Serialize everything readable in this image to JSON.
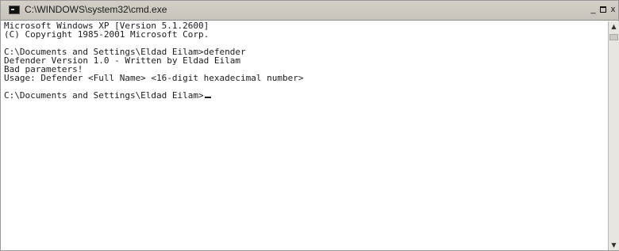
{
  "window": {
    "title": "C:\\WINDOWS\\system32\\cmd.exe",
    "icon": "cmd-icon",
    "controls": {
      "minimize": "_",
      "close": "x"
    }
  },
  "console": {
    "lines": [
      "Microsoft Windows XP [Version 5.1.2600]",
      "(C) Copyright 1985-2001 Microsoft Corp.",
      "",
      "C:\\Documents and Settings\\Eldad Eilam>defender",
      "Defender Version 1.0 - Written by Eldad Eilam",
      "Bad parameters!",
      "Usage: Defender <Full Name> <16-digit hexadecimal number>",
      "",
      "C:\\Documents and Settings\\Eldad Eilam>"
    ]
  },
  "scrollbar": {
    "up_icon": "scroll-up-arrow-icon",
    "down_icon": "scroll-down-arrow-icon"
  }
}
